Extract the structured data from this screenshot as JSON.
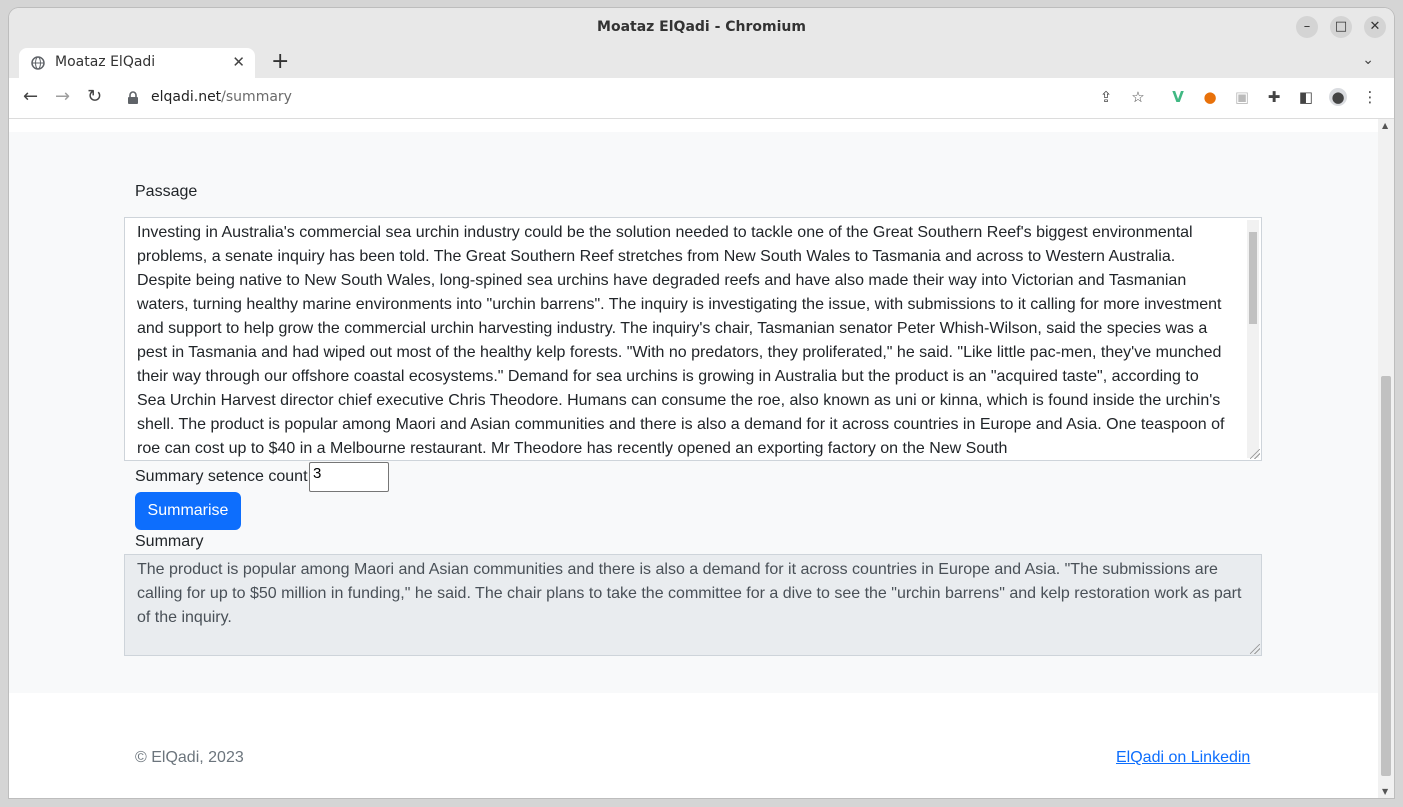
{
  "window": {
    "title": "Moataz ElQadi - Chromium",
    "minimize_glyph": "–",
    "maximize_glyph": "□",
    "close_glyph": "✕"
  },
  "tabs": [
    {
      "label": "Moataz ElQadi",
      "icon": "globe-icon",
      "close_glyph": "✕"
    }
  ],
  "new_tab_glyph": "+",
  "tab_menu_glyph": "⌄",
  "toolbar": {
    "back_glyph": "←",
    "forward_glyph": "→",
    "reload_glyph": "↻",
    "url_host": "elqadi.net",
    "url_path": "/summary",
    "icons": [
      "share-icon",
      "star-icon",
      "vue-extension-icon",
      "extension-icon",
      "extension-icon",
      "puzzle-icon",
      "sidepanel-icon",
      "profile-icon",
      "menu-icon"
    ]
  },
  "form": {
    "passage_label": "Passage",
    "passage_text": "Investing in Australia's commercial sea urchin industry could be the solution needed to tackle one of the Great Southern Reef's biggest environmental problems, a senate inquiry has been told.  The Great Southern Reef stretches from New South Wales to Tasmania and across to Western Australia.  Despite being native to New South Wales, long-spined sea urchins have degraded reefs and have also made their way into Victorian and Tasmanian waters, turning healthy marine environments into \"urchin barrens\".  The inquiry is investigating the issue, with submissions to it calling for more investment and support to help grow the commercial urchin harvesting industry.  The inquiry's chair, Tasmanian senator Peter Whish-Wilson, said the species was a pest in Tasmania and had wiped out most of the healthy kelp forests.  \"With no predators, they proliferated,\" he said.  \"Like little pac-men, they've munched their way through our offshore coastal ecosystems.\"  Demand for sea urchins is growing in Australia but the product is an \"acquired taste\", according to Sea Urchin Harvest director chief executive Chris Theodore.  Humans can consume the roe, also known as uni or kinna, which is found inside the urchin's shell.  The product is popular among Maori and Asian communities and there is also a demand for it across countries in Europe and Asia.  One teaspoon of roe can cost up to $40 in a Melbourne restaurant.  Mr Theodore has recently opened an exporting factory on the New South",
    "count_label": "Summary setence count",
    "count_value": "3",
    "submit_label": "Summarise",
    "summary_label": "Summary",
    "summary_text": "The product is popular among Maori and Asian communities and there is also a demand for it across countries in Europe and Asia. \"The submissions are calling for up to $50 million in funding,\" he said. The chair plans to take the committee for a dive to see the \"urchin barrens\" and kelp restoration work as part of the inquiry."
  },
  "footer": {
    "copyright": "© ElQadi, 2023",
    "link_label": "ElQadi on Linkedin"
  },
  "colors": {
    "primary": "#0d6efd",
    "page_bg": "#f8f9fa",
    "readonly_bg": "#e9ecef"
  }
}
